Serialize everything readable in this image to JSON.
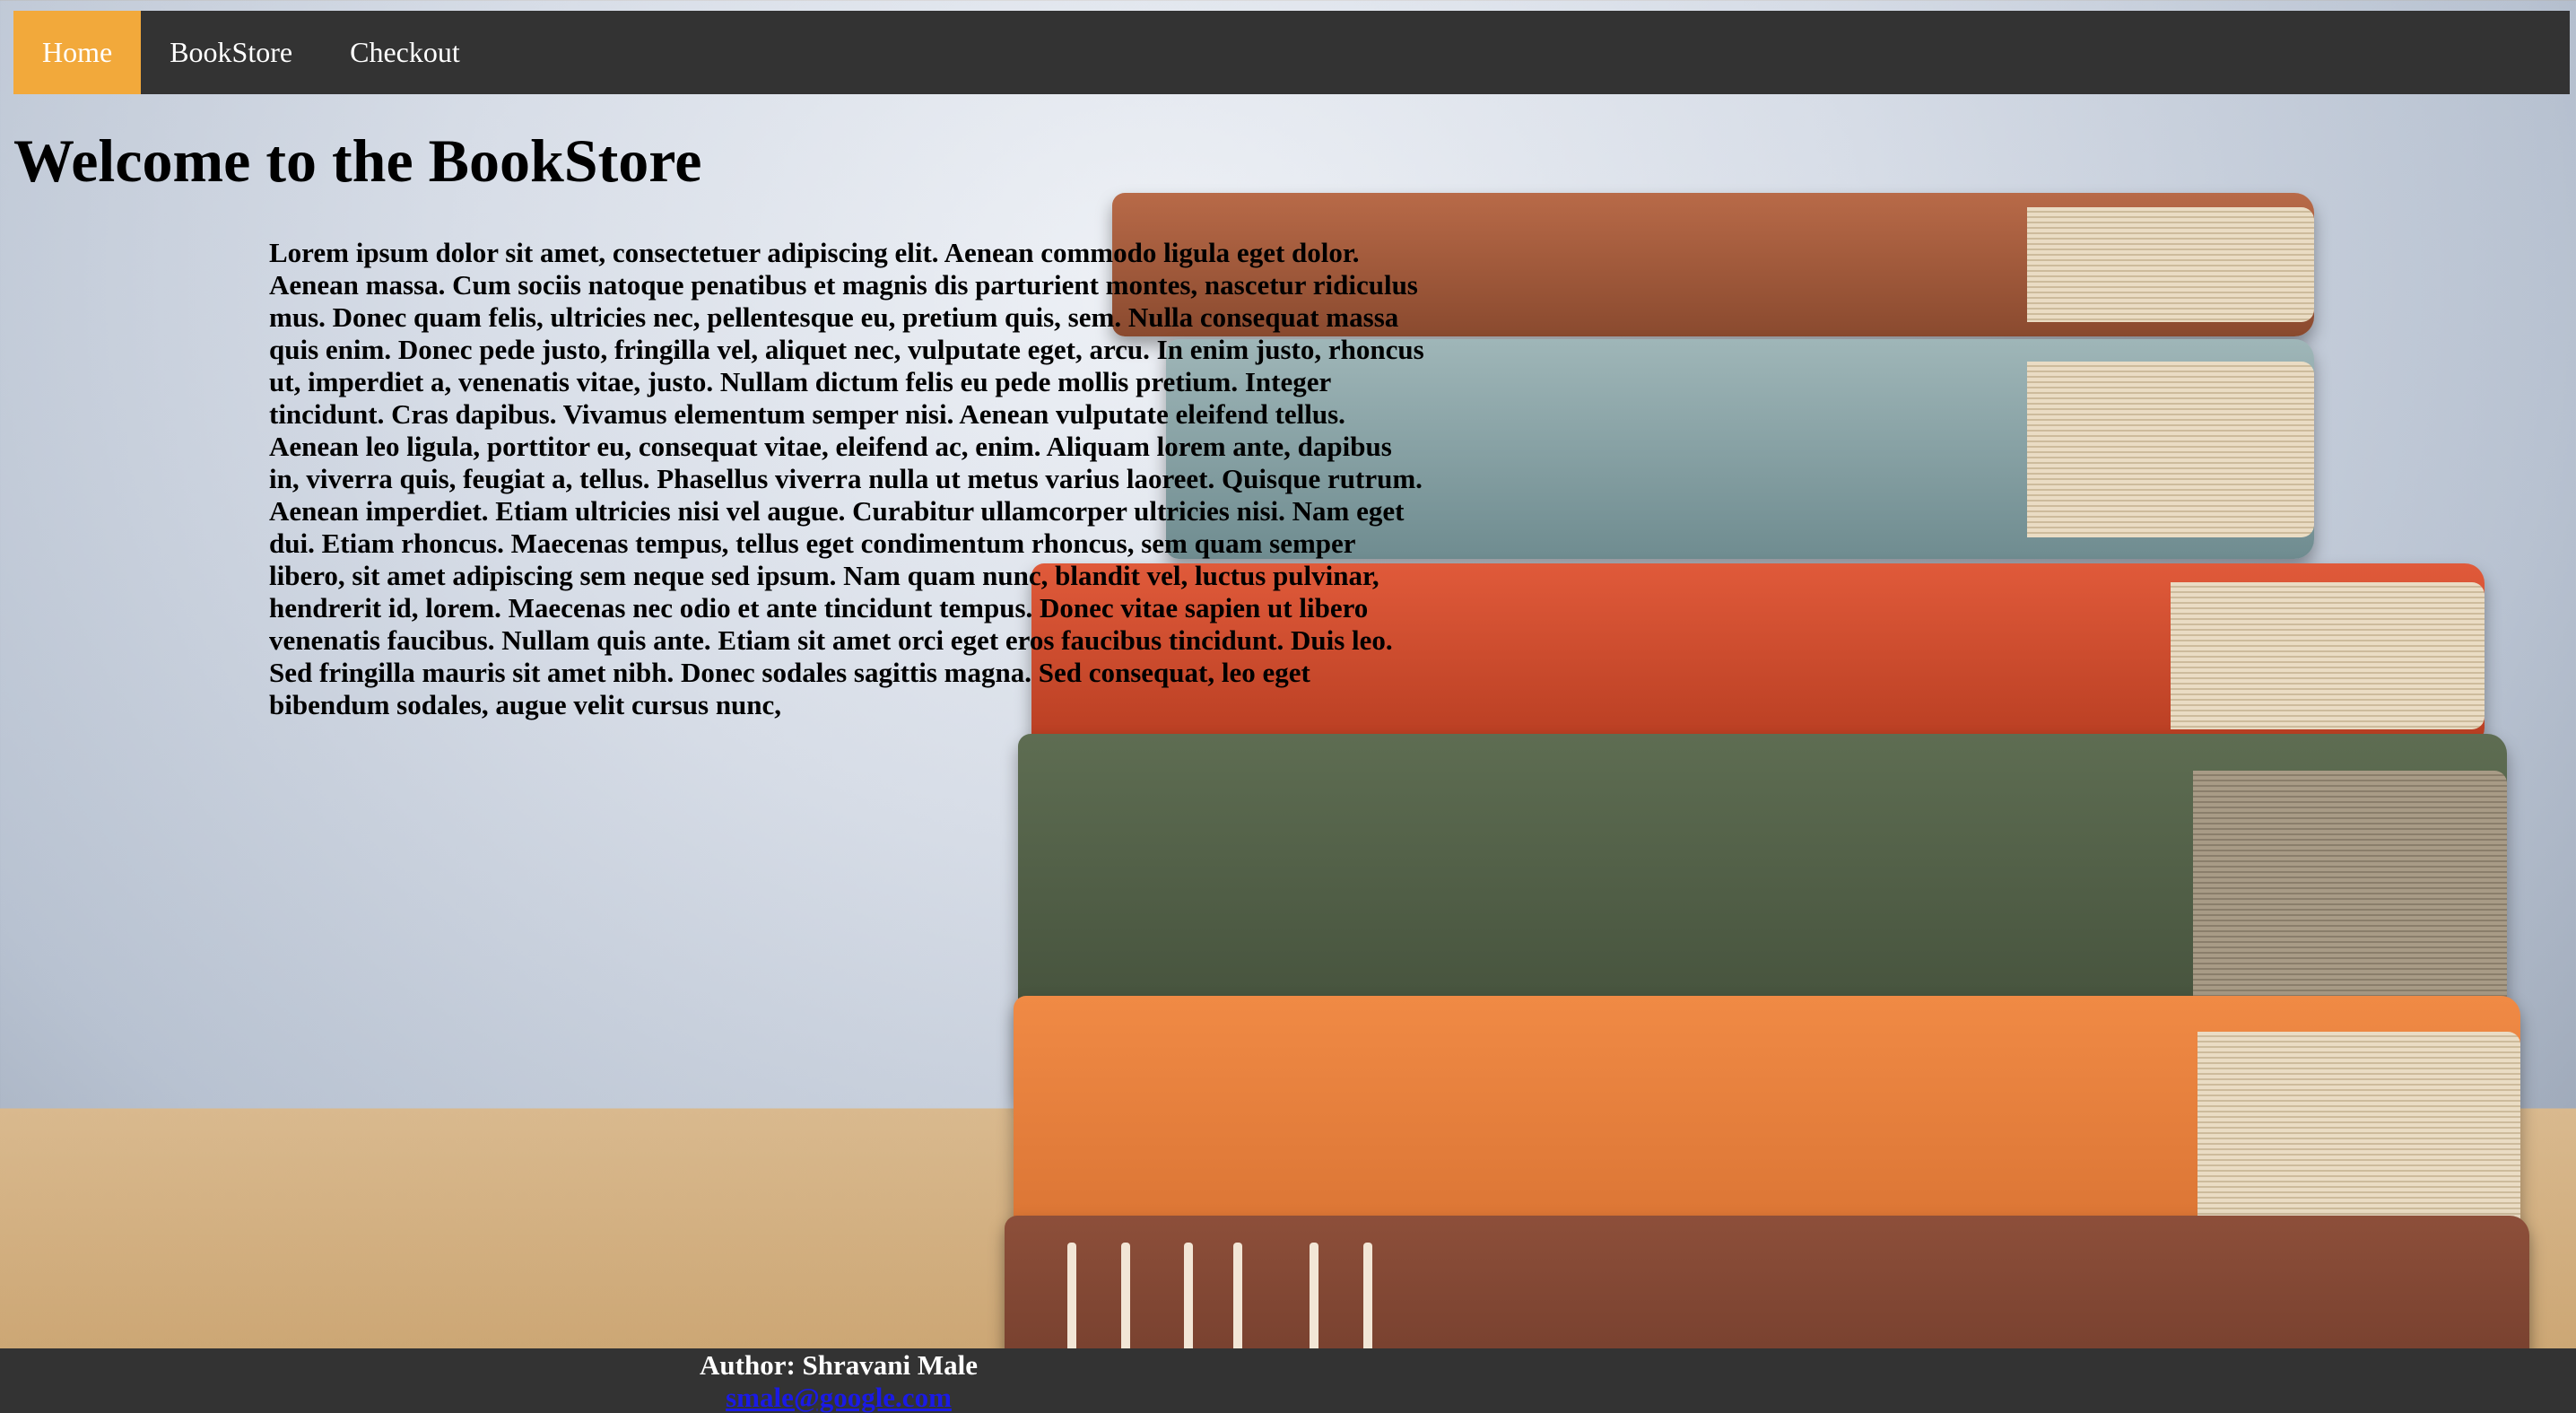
{
  "nav": {
    "items": [
      {
        "label": "Home",
        "active": true
      },
      {
        "label": "BookStore",
        "active": false
      },
      {
        "label": "Checkout",
        "active": false
      }
    ],
    "active_color": "#f2a93b",
    "bar_color": "#333333"
  },
  "main": {
    "title": "Welcome to the BookStore",
    "paragraph": "Lorem ipsum dolor sit amet, consectetuer adipiscing elit. Aenean commodo ligula eget dolor. Aenean massa. Cum sociis natoque penatibus et magnis dis parturient montes, nascetur ridiculus mus. Donec quam felis, ultricies nec, pellentesque eu, pretium quis, sem. Nulla consequat massa quis enim. Donec pede justo, fringilla vel, aliquet nec, vulputate eget, arcu. In enim justo, rhoncus ut, imperdiet a, venenatis vitae, justo. Nullam dictum felis eu pede mollis pretium. Integer tincidunt. Cras dapibus. Vivamus elementum semper nisi. Aenean vulputate eleifend tellus. Aenean leo ligula, porttitor eu, consequat vitae, eleifend ac, enim. Aliquam lorem ante, dapibus in, viverra quis, feugiat a, tellus. Phasellus viverra nulla ut metus varius laoreet. Quisque rutrum. Aenean imperdiet. Etiam ultricies nisi vel augue. Curabitur ullamcorper ultricies nisi. Nam eget dui. Etiam rhoncus. Maecenas tempus, tellus eget condimentum rhoncus, sem quam semper libero, sit amet adipiscing sem neque sed ipsum. Nam quam nunc, blandit vel, luctus pulvinar, hendrerit id, lorem. Maecenas nec odio et ante tincidunt tempus. Donec vitae sapien ut libero venenatis faucibus. Nullam quis ante. Etiam sit amet orci eget eros faucibus tincidunt. Duis leo. Sed fringilla mauris sit amet nibh. Donec sodales sagittis magna. Sed consequat, leo eget bibendum sodales, augue velit cursus nunc,"
  },
  "footer": {
    "author": "Author: Shravani Male",
    "email": "smale@google.com"
  }
}
